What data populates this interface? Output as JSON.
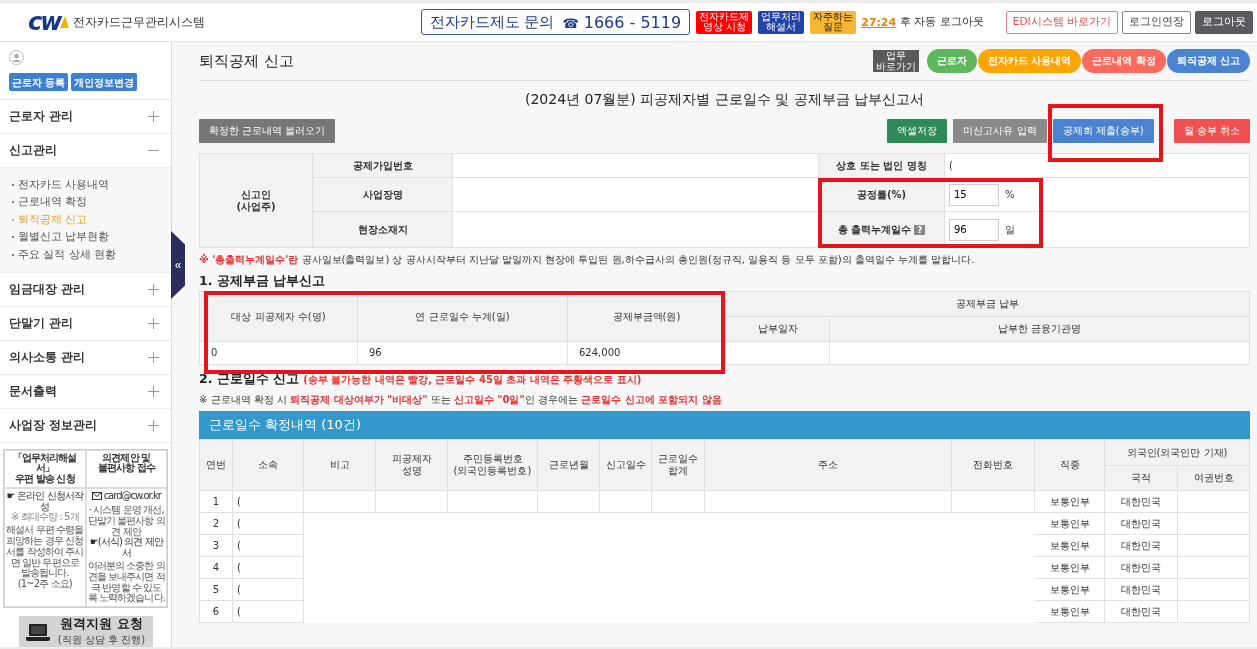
{
  "header": {
    "logo_mark": "cw",
    "logo_text": "전자카드근무관리시스템",
    "inquiry_label": "전자카드제도 문의",
    "phone_icon": "☎",
    "phone": "1666 - 5119",
    "quick_links": [
      {
        "label": "전자카드제\n영상 시청",
        "color": "#ff0000"
      },
      {
        "label": "업무처리\n해설서",
        "color": "#2244aa"
      },
      {
        "label": "자주하는\n질문",
        "color": "#f7b731"
      }
    ],
    "timer": "27:24",
    "timer_text": "후 자동 로그아웃",
    "actions": [
      {
        "label": "EDI시스템 바로가기",
        "kind": "outline-red"
      },
      {
        "label": "로그인연장",
        "kind": "outline"
      },
      {
        "label": "로그아웃",
        "kind": "dark"
      }
    ]
  },
  "user": {
    "buttons": [
      "근로자 등록",
      "개인정보변경"
    ]
  },
  "menu": [
    {
      "label": "근로자 관리",
      "expanded": false
    },
    {
      "label": "신고관리",
      "expanded": true,
      "children": [
        {
          "label": "전자카드 사용내역",
          "selected": false
        },
        {
          "label": "근로내역 확정",
          "selected": false
        },
        {
          "label": "퇴직공제 신고",
          "selected": true
        },
        {
          "label": "월별신고 납부현황",
          "selected": false
        },
        {
          "label": "주요 실적 상세 현황",
          "selected": false
        }
      ]
    },
    {
      "label": "임금대장 관리",
      "expanded": false
    },
    {
      "label": "단말기 관리",
      "expanded": false
    },
    {
      "label": "의사소통 관리",
      "expanded": false
    },
    {
      "label": "문서출력",
      "expanded": false
    },
    {
      "label": "사업장 정보관리",
      "expanded": false
    }
  ],
  "notice": {
    "left": {
      "title": "「업무처리해설서」\n우편 발송 신청",
      "link": "☛ 온라인 신청서작성",
      "note": "※ 최대수량 : 5개",
      "text": "해설서 우편 수령을 희망하는 경우 신청서를 작성하여 주시면 일반 우편으로 발송됩니다.\n(1~2주 소요)"
    },
    "right": {
      "title": "의견제안 및\n불편사항 접수",
      "email": "card@cw.or.kr",
      "text": "· 시스템 운영 개선, 단말기 불편사항 의견 제안",
      "link": "☛(서식) 의견 제안서",
      "closing": "여러분의 소중한 의견을 보내주시면 적극 반영할 수 있도록 노력하겠습니다."
    }
  },
  "remote": {
    "title": "원격지원 요청",
    "subtitle": "(직원 상담 후 진행)"
  },
  "collapse_icon": "«",
  "page": {
    "title": "퇴직공제 신고",
    "shortcut_label": "업무\n바로가기",
    "steps": [
      {
        "label": "근로자",
        "color": "#5cb85c"
      },
      {
        "label": "전자카드 사용내역",
        "color": "#ffa500"
      },
      {
        "label": "근로내역 확정",
        "color": "#ff6a5c"
      },
      {
        "label": "퇴직공제 신고",
        "color": "#4a84d0"
      }
    ],
    "form_title": "(2024년 07월분) 피공제자별 근로일수 및 공제부금 납부신고서",
    "load_button": "확정한 근로내역 불러오기",
    "actions": [
      {
        "label": "엑셀저장",
        "color": "#2e8b57"
      },
      {
        "label": "미신고사유 입력",
        "color": "#8a8a8a"
      },
      {
        "label": "공제회 제출(송부)",
        "color": "#4a84d0"
      },
      {
        "label": "월 송부 취소",
        "color": "#f05050"
      }
    ],
    "reporter": {
      "label": "신고인\n(사업주)",
      "fields": [
        "공제가입번호",
        "사업장명",
        "현장소재지"
      ],
      "details": [
        {
          "label": "상호 또는 법인 명칭",
          "kind": "text",
          "value": "("
        },
        {
          "label": "공정률(%)",
          "kind": "input",
          "value": "15",
          "unit": "%"
        },
        {
          "label": "총 출력누계일수",
          "kind": "input",
          "help": "?",
          "value": "96",
          "unit": "일"
        }
      ]
    },
    "note": [
      {
        "text": "※ '총출력누계일수'란",
        "emphasis": true
      },
      {
        "text": " 공사일보(출력일보) 상 공사시작부터 지난달 말일까지 현장에 투입된 원,하수급사의 총인원(정규직, 일용직 등 모두 포함)의 출역일수 누계를 말합니다.",
        "emphasis": false
      }
    ],
    "section1": "1. 공제부금 납부신고",
    "payment": {
      "columns": [
        "대상 피공제자 수(명)",
        "연 근로일수 누계(일)",
        "공제부금액(원)"
      ],
      "group": "공제부금 납부",
      "group_columns": [
        "납부일자",
        "납부한 금융기관명"
      ],
      "row": [
        "0",
        "96",
        "624,000"
      ]
    },
    "section2": "2. 근로일수 신고",
    "section2_legend": "(송부 불가능한 내역은 빨강, 근로일수 45일 초과 내역은 주황색으로 표시)",
    "note2": [
      {
        "text": "※ 근로내역 확정 시 ",
        "emphasis": false
      },
      {
        "text": "퇴직공제 대상여부가 \"비대상\"",
        "emphasis": true
      },
      {
        "text": " 또는 ",
        "emphasis": false
      },
      {
        "text": "신고일수 \"0일\"",
        "emphasis": true
      },
      {
        "text": "인 경우에는 ",
        "emphasis": false
      },
      {
        "text": "근로일수 신고에 포함되지 않음",
        "emphasis": true
      }
    ],
    "work": {
      "caption": "근로일수 확정내역 (10건)",
      "columns": [
        "연번",
        "소속",
        "비고",
        "피공제자\n성명",
        "주민등록번호\n(외국인등록번호)",
        "근로년월",
        "신고일수",
        "근로일수\n합계",
        "주소",
        "전화번호",
        "직종"
      ],
      "group": "외국인(외국인만 기재)",
      "group_columns": [
        "국적",
        "여권번호"
      ],
      "rows": [
        {
          "no": "1",
          "affiliation": "(",
          "job": "보통인부",
          "nationality": "대한민국"
        },
        {
          "no": "2",
          "affiliation": "(",
          "job": "보통인부",
          "nationality": "대한민국"
        },
        {
          "no": "3",
          "affiliation": "(",
          "job": "보통인부",
          "nationality": "대한민국"
        },
        {
          "no": "4",
          "affiliation": "(",
          "job": "보통인부",
          "nationality": "대한민국"
        },
        {
          "no": "5",
          "affiliation": "(",
          "job": "보통인부",
          "nationality": "대한민국"
        },
        {
          "no": "6",
          "affiliation": "(",
          "job": "보통인부",
          "nationality": "대한민국"
        }
      ]
    }
  }
}
